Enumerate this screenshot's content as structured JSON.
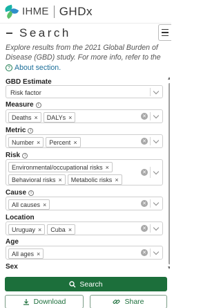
{
  "header": {
    "brand": "IHME",
    "product": "GHDx"
  },
  "search_panel": {
    "title": "Search",
    "intro": "Explore results from the 2021 Global Burden of Disease (GBD) study. For more info, refer to the",
    "about_link": "About section."
  },
  "form": {
    "gbd_estimate": {
      "label": "GBD Estimate",
      "value": "Risk factor"
    },
    "measure": {
      "label": "Measure",
      "chips": [
        "Deaths",
        "DALYs"
      ]
    },
    "metric": {
      "label": "Metric",
      "chips": [
        "Number",
        "Percent"
      ]
    },
    "risk": {
      "label": "Risk",
      "chips": [
        "Environmental/occupational risks",
        "Behavioral risks",
        "Metabolic risks"
      ]
    },
    "cause": {
      "label": "Cause",
      "chips": [
        "All causes"
      ]
    },
    "location": {
      "label": "Location",
      "chips": [
        "Uruguay",
        "Cuba"
      ]
    },
    "age": {
      "label": "Age",
      "chips": [
        "All ages"
      ]
    },
    "sex": {
      "label": "Sex"
    }
  },
  "actions": {
    "search": "Search",
    "download": "Download",
    "share": "Share"
  },
  "colors": {
    "primary": "#1c6f3b",
    "link": "#1b6e99"
  },
  "icons": {
    "remove": "×",
    "clear": "✕"
  }
}
